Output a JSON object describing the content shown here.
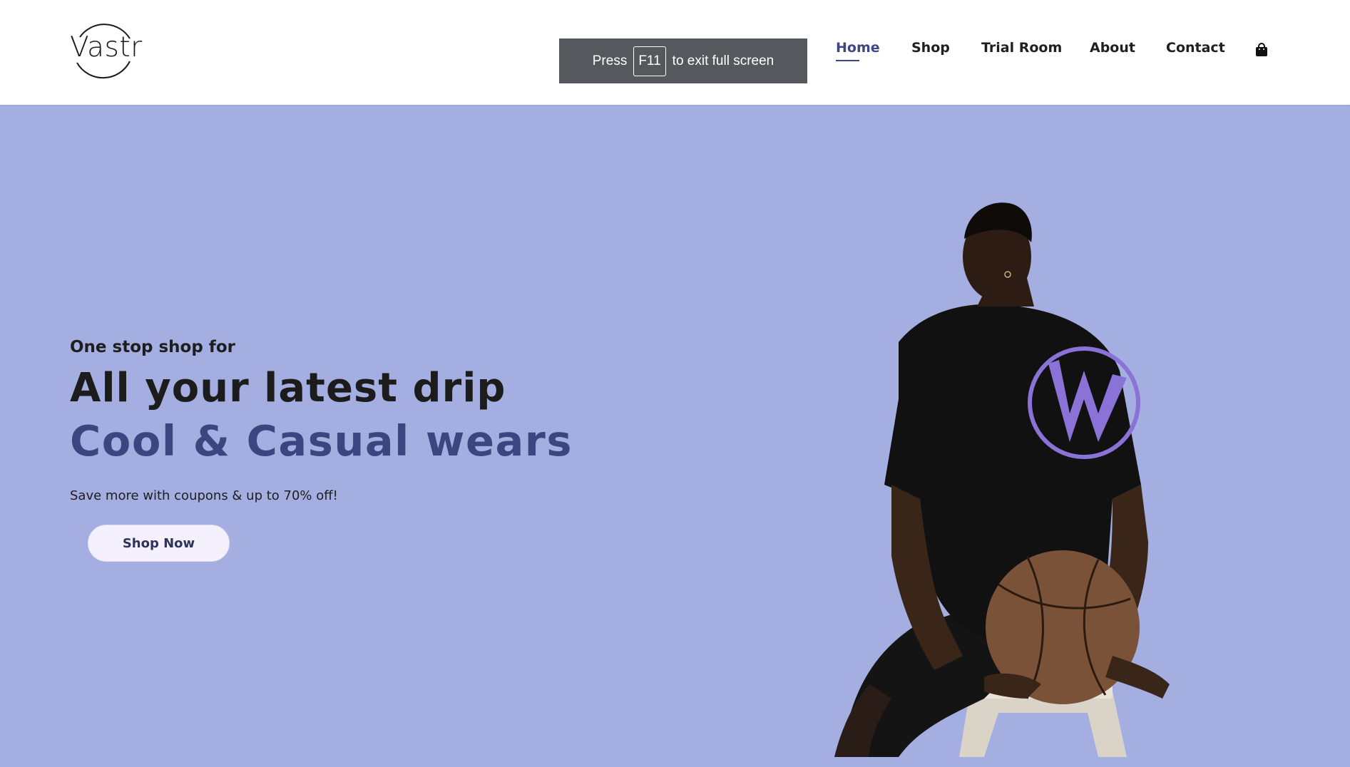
{
  "header": {
    "logo_text": "Vastr",
    "fullscreen_toast": {
      "prefix": "Press",
      "key": "F11",
      "suffix": "to exit full screen"
    },
    "nav": [
      {
        "label": "Home",
        "active": true
      },
      {
        "label": "Shop",
        "active": false
      },
      {
        "label": "Trial Room",
        "active": false
      },
      {
        "label": "About",
        "active": false
      },
      {
        "label": "Contact",
        "active": false
      }
    ],
    "cart_icon": "shopping-bag-icon"
  },
  "hero": {
    "subtitle": "One stop shop for",
    "title_line1": "All your latest drip",
    "title_line2": "Cool & Casual wears",
    "description": "Save more with coupons & up to 70% off!",
    "cta_label": "Shop Now",
    "image": "model-with-basketball"
  },
  "colors": {
    "hero_bg": "#a4aee0",
    "accent": "#3d4783",
    "header_bg": "#ffffff",
    "toast_bg": "#55595d",
    "cta_bg": "#f4f0fc"
  }
}
